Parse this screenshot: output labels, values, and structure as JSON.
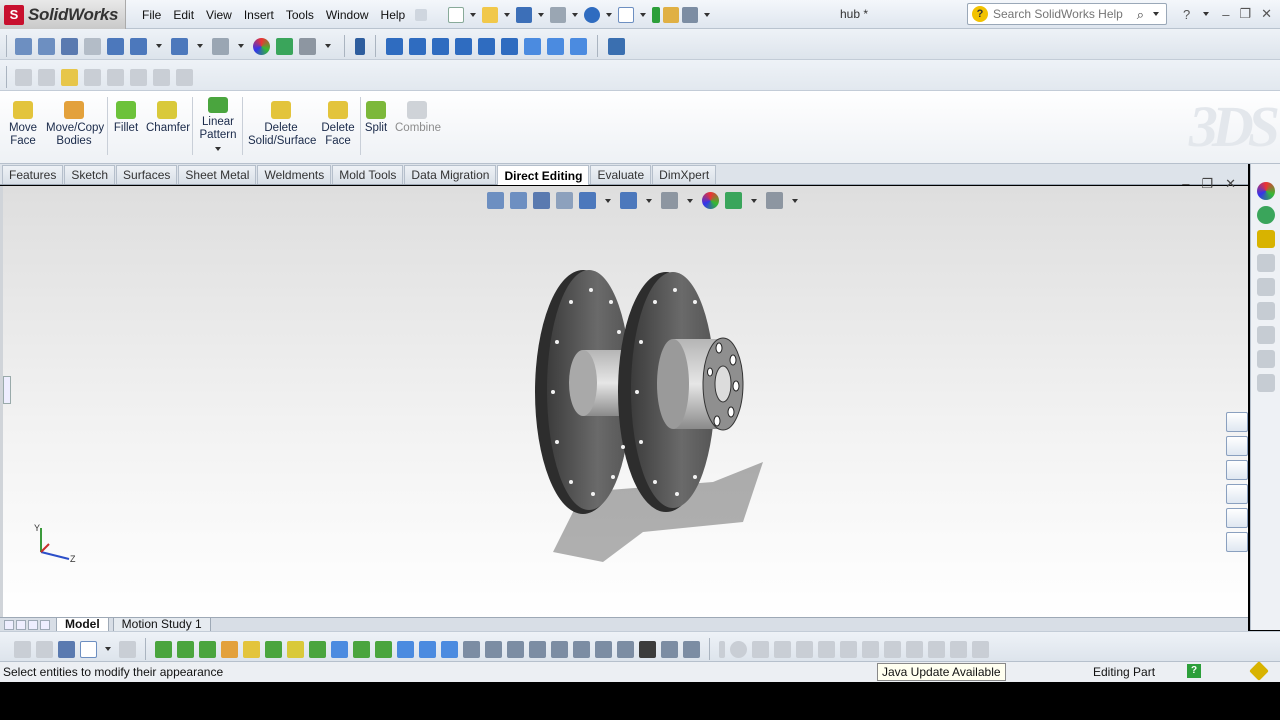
{
  "app": {
    "name": "SolidWorks",
    "document_title": "hub *"
  },
  "menu": [
    "File",
    "Edit",
    "View",
    "Insert",
    "Tools",
    "Window",
    "Help"
  ],
  "search": {
    "placeholder": "Search SolidWorks Help"
  },
  "command_manager": {
    "move_face": "Move\nFace",
    "move_copy_bodies": "Move/Copy\nBodies",
    "fillet": "Fillet",
    "chamfer": "Chamfer",
    "linear_pattern": "Linear\nPattern",
    "delete_solid_surface": "Delete\nSolid/Surface",
    "delete_face": "Delete\nFace",
    "split": "Split",
    "combine": "Combine"
  },
  "tabs": [
    "Features",
    "Sketch",
    "Surfaces",
    "Sheet Metal",
    "Weldments",
    "Mold Tools",
    "Data Migration",
    "Direct Editing",
    "Evaluate",
    "DimXpert"
  ],
  "active_tab": "Direct Editing",
  "triad": {
    "y": "Y",
    "z": "Z"
  },
  "model_tabs": {
    "model": "Model",
    "motion_study": "Motion Study 1"
  },
  "status": {
    "message": "Select entities to modify their appearance",
    "java_tip": "Java Update Available",
    "edit_state": "Editing Part",
    "help_glyph": "?"
  },
  "colors": {
    "accent": "#c8102e",
    "viewport_top": "#dedede",
    "viewport_bottom": "#ffffff"
  }
}
